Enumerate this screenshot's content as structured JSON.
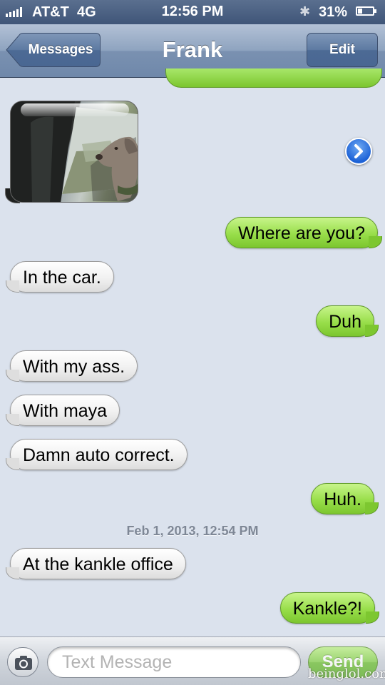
{
  "status_bar": {
    "carrier": "AT&T",
    "network": "4G",
    "time": "12:56 PM",
    "battery": "31%",
    "battery_level": 0.31,
    "icons": [
      "signal-bars-icon",
      "bluetooth-icon",
      "battery-icon"
    ]
  },
  "nav": {
    "back_label": "Messages",
    "title": "Frank",
    "edit_label": "Edit"
  },
  "messages": [
    {
      "from": "me",
      "text": "Where are you?"
    },
    {
      "from": "them",
      "text": "In the car."
    },
    {
      "from": "me",
      "text": "Duh"
    },
    {
      "from": "them",
      "text": "With my ass."
    },
    {
      "from": "them",
      "text": "With maya"
    },
    {
      "from": "them",
      "text": "Damn auto correct."
    },
    {
      "from": "me",
      "text": "Huh."
    },
    {
      "from": "them",
      "text": "At the kankle office"
    },
    {
      "from": "me",
      "text": "Kankle?!"
    }
  ],
  "timestamp": "Feb 1, 2013, 12:54 PM",
  "input": {
    "placeholder": "Text Message",
    "send_label": "Send"
  },
  "watermark": "beinglol.com",
  "colors": {
    "sent_bubble": "#98de4a",
    "received_bubble": "#f1f1f1",
    "nav_bar": "#6f88aa",
    "background": "#dbe2ed"
  }
}
